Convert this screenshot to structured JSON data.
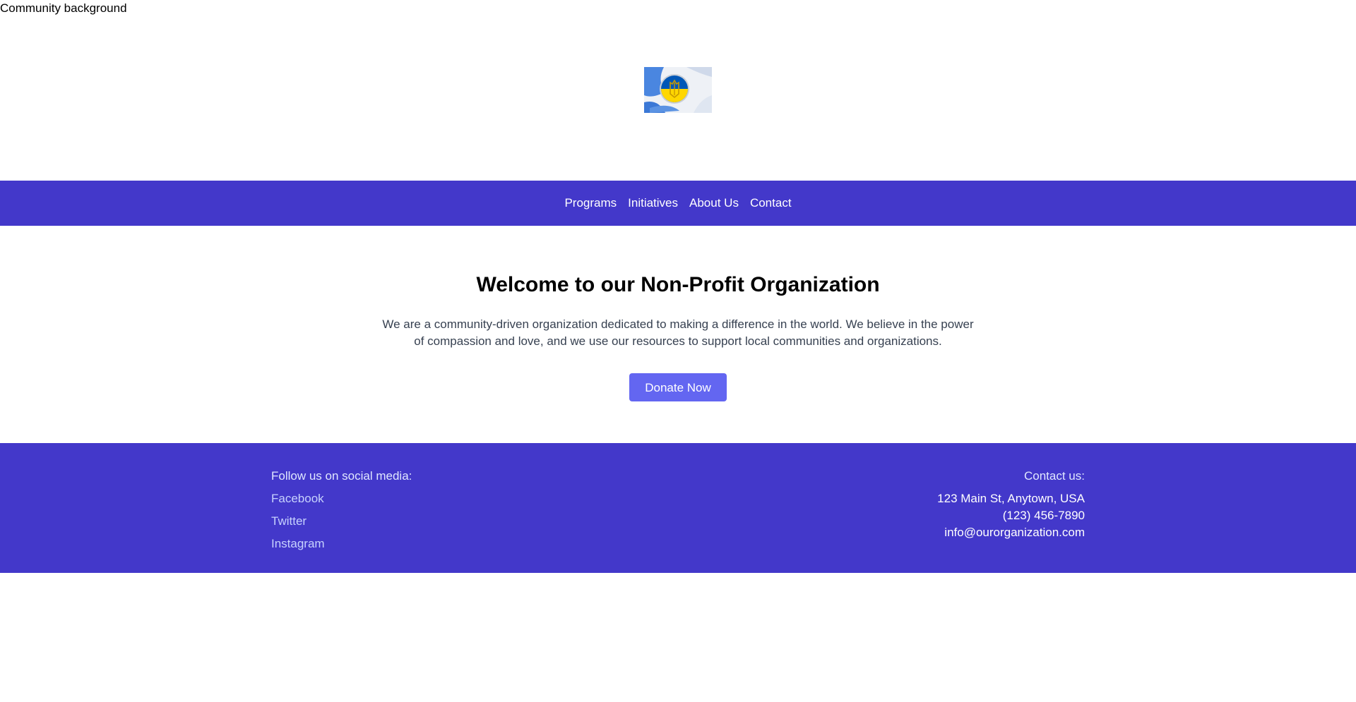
{
  "background_alt": "Community background",
  "logo": {
    "icon": "ukraine-flag-badge-icon",
    "colors": {
      "blue": "#0057b7",
      "yellow": "#ffd700"
    }
  },
  "nav": {
    "items": [
      {
        "label": "Programs"
      },
      {
        "label": "Initiatives"
      },
      {
        "label": "About Us"
      },
      {
        "label": "Contact"
      }
    ]
  },
  "hero": {
    "title": "Welcome to our Non-Profit Organization",
    "description": "We are a community-driven organization dedicated to making a difference in the world. We believe in the power of compassion and love, and we use our resources to support local communities and organizations.",
    "donate_label": "Donate Now"
  },
  "footer": {
    "social_heading": "Follow us on social media:",
    "social_links": [
      {
        "label": "Facebook"
      },
      {
        "label": "Twitter"
      },
      {
        "label": "Instagram"
      }
    ],
    "contact_heading": "Contact us:",
    "address": "123 Main St, Anytown, USA",
    "phone": "(123) 456-7890",
    "email": "info@ourorganization.com"
  },
  "colors": {
    "brand": "#4338ca",
    "button": "#6366f1"
  }
}
